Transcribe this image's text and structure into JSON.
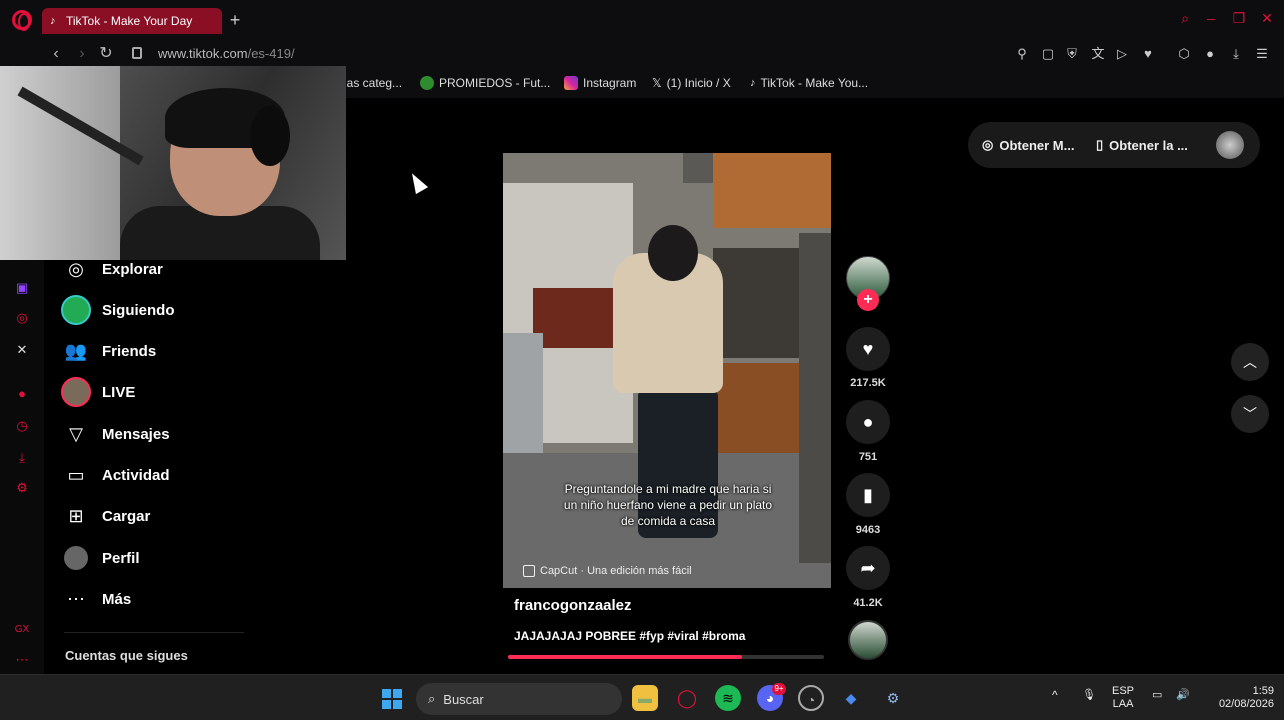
{
  "browser": {
    "tab_title": "TikTok - Make Your Day",
    "new_tab": "+",
    "url_host": "www.tiktok.com",
    "url_path": "/es-419/",
    "bookmarks": [
      {
        "label": "las categ...",
        "color": "#555555"
      },
      {
        "label": "PROMIEDOS - Fut...",
        "color": "#2e8b2e"
      },
      {
        "label": "Instagram",
        "color": "#d6249f"
      },
      {
        "label": "(1) Inicio / X",
        "color": "#000000"
      },
      {
        "label": "TikTok - Make You...",
        "color": "#000000"
      }
    ]
  },
  "nav": {
    "items": [
      {
        "label": "Explorar",
        "icon": "compass-icon"
      },
      {
        "label": "Siguiendo",
        "icon": "following-avatar"
      },
      {
        "label": "Friends",
        "icon": "friends-icon"
      },
      {
        "label": "LIVE",
        "icon": "live-avatar"
      },
      {
        "label": "Mensajes",
        "icon": "send-icon"
      },
      {
        "label": "Actividad",
        "icon": "message-icon"
      },
      {
        "label": "Cargar",
        "icon": "plus-square-icon"
      },
      {
        "label": "Perfil",
        "icon": "profile-avatar"
      },
      {
        "label": "Más",
        "icon": "more-icon"
      }
    ],
    "following_title": "Cuentas que sigues"
  },
  "video": {
    "caption": "Preguntandole a mi madre que haria si un niño huerfano viene a pedir un plato de comida a casa",
    "capcut": "CapCut · Una edición más fácil",
    "author": "francogonzaalez",
    "description": "JAJAJAJAJ POBREE #fyp #viral #broma",
    "progress": 0.74
  },
  "actions": {
    "likes": "217.5K",
    "comments": "751",
    "saves": "9463",
    "shares": "41.2K"
  },
  "top_pill": {
    "item1": "Obtener M...",
    "item2": "Obtener la ..."
  },
  "taskbar": {
    "search_placeholder": "Buscar",
    "lang_top": "ESP",
    "lang_bottom": "LAA",
    "time": "1:59",
    "date": "02/08/2026",
    "discord_badge": "9+"
  },
  "colors": {
    "accent": "#fe2c55",
    "opera_red": "#e0103a"
  }
}
